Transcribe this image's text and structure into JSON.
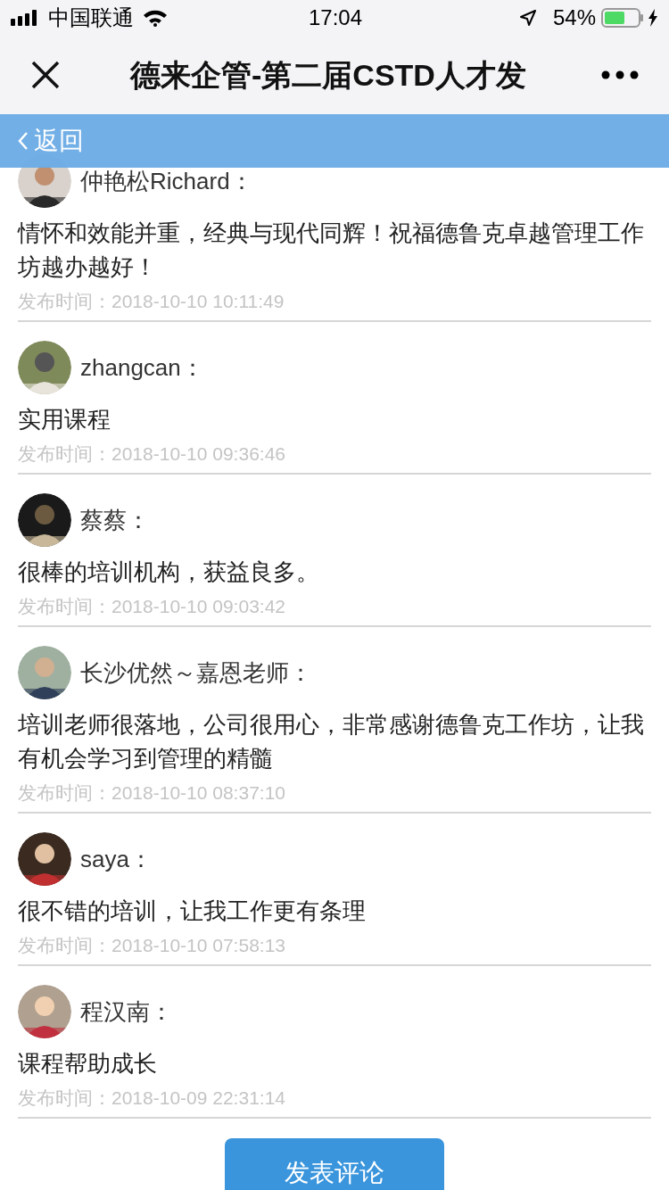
{
  "status_bar": {
    "carrier": "中国联通",
    "time": "17:04",
    "battery": "54%"
  },
  "nav_bar": {
    "title": "德来企管-第二届CSTD人才发"
  },
  "back_bar": {
    "label": "返回"
  },
  "comments": [
    {
      "author": "仲艳松Richard：",
      "text": "情怀和效能并重，经典与现代同辉！祝福德鲁克卓越管理工作坊越办越好！",
      "time": "发布时间：2018-10-10 10:11:49"
    },
    {
      "author": "zhangcan：",
      "text": "实用课程",
      "time": "发布时间：2018-10-10 09:36:46"
    },
    {
      "author": "蔡蔡：",
      "text": "很棒的培训机构，获益良多。",
      "time": "发布时间：2018-10-10 09:03:42"
    },
    {
      "author": "长沙优然～嘉恩老师：",
      "text": "培训老师很落地，公司很用心，非常感谢德鲁克工作坊，让我有机会学习到管理的精髓",
      "time": "发布时间：2018-10-10 08:37:10"
    },
    {
      "author": "saya：",
      "text": "很不错的培训，让我工作更有条理",
      "time": "发布时间：2018-10-10 07:58:13"
    },
    {
      "author": "程汉南：",
      "text": "课程帮助成长",
      "time": "发布时间：2018-10-09 22:31:14"
    }
  ],
  "submit_button": {
    "label": "发表评论"
  }
}
